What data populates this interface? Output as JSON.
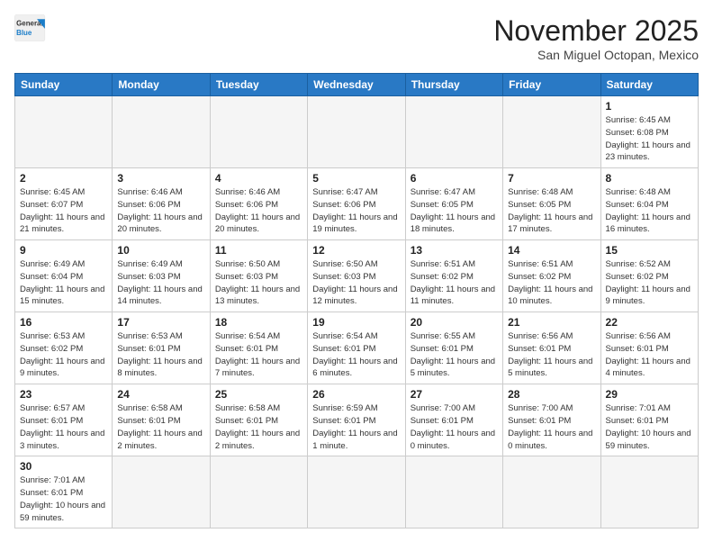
{
  "header": {
    "logo_general": "General",
    "logo_blue": "Blue",
    "month_title": "November 2025",
    "location": "San Miguel Octopan, Mexico"
  },
  "days_of_week": [
    "Sunday",
    "Monday",
    "Tuesday",
    "Wednesday",
    "Thursday",
    "Friday",
    "Saturday"
  ],
  "weeks": [
    [
      {
        "day": "",
        "info": ""
      },
      {
        "day": "",
        "info": ""
      },
      {
        "day": "",
        "info": ""
      },
      {
        "day": "",
        "info": ""
      },
      {
        "day": "",
        "info": ""
      },
      {
        "day": "",
        "info": ""
      },
      {
        "day": "1",
        "info": "Sunrise: 6:45 AM\nSunset: 6:08 PM\nDaylight: 11 hours and 23 minutes."
      }
    ],
    [
      {
        "day": "2",
        "info": "Sunrise: 6:45 AM\nSunset: 6:07 PM\nDaylight: 11 hours and 21 minutes."
      },
      {
        "day": "3",
        "info": "Sunrise: 6:46 AM\nSunset: 6:06 PM\nDaylight: 11 hours and 20 minutes."
      },
      {
        "day": "4",
        "info": "Sunrise: 6:46 AM\nSunset: 6:06 PM\nDaylight: 11 hours and 20 minutes."
      },
      {
        "day": "5",
        "info": "Sunrise: 6:47 AM\nSunset: 6:06 PM\nDaylight: 11 hours and 19 minutes."
      },
      {
        "day": "6",
        "info": "Sunrise: 6:47 AM\nSunset: 6:05 PM\nDaylight: 11 hours and 18 minutes."
      },
      {
        "day": "7",
        "info": "Sunrise: 6:48 AM\nSunset: 6:05 PM\nDaylight: 11 hours and 17 minutes."
      },
      {
        "day": "8",
        "info": "Sunrise: 6:48 AM\nSunset: 6:04 PM\nDaylight: 11 hours and 16 minutes."
      }
    ],
    [
      {
        "day": "9",
        "info": "Sunrise: 6:49 AM\nSunset: 6:04 PM\nDaylight: 11 hours and 15 minutes."
      },
      {
        "day": "10",
        "info": "Sunrise: 6:49 AM\nSunset: 6:03 PM\nDaylight: 11 hours and 14 minutes."
      },
      {
        "day": "11",
        "info": "Sunrise: 6:50 AM\nSunset: 6:03 PM\nDaylight: 11 hours and 13 minutes."
      },
      {
        "day": "12",
        "info": "Sunrise: 6:50 AM\nSunset: 6:03 PM\nDaylight: 11 hours and 12 minutes."
      },
      {
        "day": "13",
        "info": "Sunrise: 6:51 AM\nSunset: 6:02 PM\nDaylight: 11 hours and 11 minutes."
      },
      {
        "day": "14",
        "info": "Sunrise: 6:51 AM\nSunset: 6:02 PM\nDaylight: 11 hours and 10 minutes."
      },
      {
        "day": "15",
        "info": "Sunrise: 6:52 AM\nSunset: 6:02 PM\nDaylight: 11 hours and 9 minutes."
      }
    ],
    [
      {
        "day": "16",
        "info": "Sunrise: 6:53 AM\nSunset: 6:02 PM\nDaylight: 11 hours and 9 minutes."
      },
      {
        "day": "17",
        "info": "Sunrise: 6:53 AM\nSunset: 6:01 PM\nDaylight: 11 hours and 8 minutes."
      },
      {
        "day": "18",
        "info": "Sunrise: 6:54 AM\nSunset: 6:01 PM\nDaylight: 11 hours and 7 minutes."
      },
      {
        "day": "19",
        "info": "Sunrise: 6:54 AM\nSunset: 6:01 PM\nDaylight: 11 hours and 6 minutes."
      },
      {
        "day": "20",
        "info": "Sunrise: 6:55 AM\nSunset: 6:01 PM\nDaylight: 11 hours and 5 minutes."
      },
      {
        "day": "21",
        "info": "Sunrise: 6:56 AM\nSunset: 6:01 PM\nDaylight: 11 hours and 5 minutes."
      },
      {
        "day": "22",
        "info": "Sunrise: 6:56 AM\nSunset: 6:01 PM\nDaylight: 11 hours and 4 minutes."
      }
    ],
    [
      {
        "day": "23",
        "info": "Sunrise: 6:57 AM\nSunset: 6:01 PM\nDaylight: 11 hours and 3 minutes."
      },
      {
        "day": "24",
        "info": "Sunrise: 6:58 AM\nSunset: 6:01 PM\nDaylight: 11 hours and 2 minutes."
      },
      {
        "day": "25",
        "info": "Sunrise: 6:58 AM\nSunset: 6:01 PM\nDaylight: 11 hours and 2 minutes."
      },
      {
        "day": "26",
        "info": "Sunrise: 6:59 AM\nSunset: 6:01 PM\nDaylight: 11 hours and 1 minute."
      },
      {
        "day": "27",
        "info": "Sunrise: 7:00 AM\nSunset: 6:01 PM\nDaylight: 11 hours and 0 minutes."
      },
      {
        "day": "28",
        "info": "Sunrise: 7:00 AM\nSunset: 6:01 PM\nDaylight: 11 hours and 0 minutes."
      },
      {
        "day": "29",
        "info": "Sunrise: 7:01 AM\nSunset: 6:01 PM\nDaylight: 10 hours and 59 minutes."
      }
    ],
    [
      {
        "day": "30",
        "info": "Sunrise: 7:01 AM\nSunset: 6:01 PM\nDaylight: 10 hours and 59 minutes."
      },
      {
        "day": "",
        "info": ""
      },
      {
        "day": "",
        "info": ""
      },
      {
        "day": "",
        "info": ""
      },
      {
        "day": "",
        "info": ""
      },
      {
        "day": "",
        "info": ""
      },
      {
        "day": "",
        "info": ""
      }
    ]
  ]
}
